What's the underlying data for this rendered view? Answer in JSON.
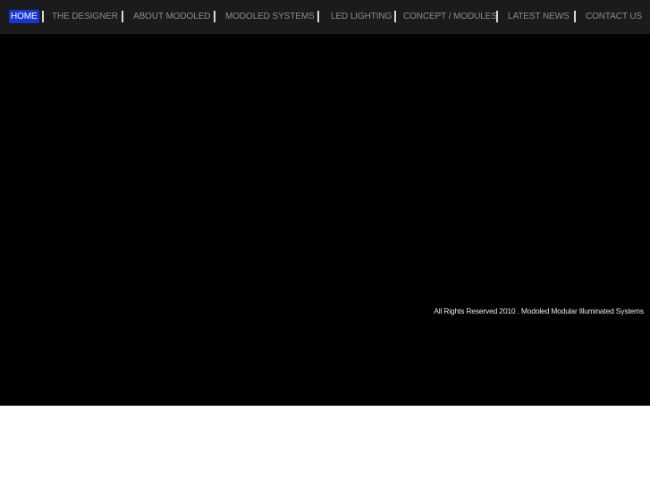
{
  "colors": {
    "nav_background": "#1b1b1b",
    "stage_background": "#000000",
    "page_background": "#ffffff",
    "nav_text": "#8c8c8c",
    "active_highlight": "#1a35d6",
    "separator": "#d9d9d9"
  },
  "nav": {
    "active": "home",
    "items": [
      {
        "id": "home",
        "label": "HOME"
      },
      {
        "id": "designer",
        "label": "THE DESIGNER"
      },
      {
        "id": "about",
        "label": "ABOUT MODOLED"
      },
      {
        "id": "systems",
        "label": "MODOLED SYSTEMS"
      },
      {
        "id": "led",
        "label": "LED LIGHTING"
      },
      {
        "id": "concept",
        "label": "CONCEPT / MODULES"
      },
      {
        "id": "news",
        "label": "LATEST NEWS"
      },
      {
        "id": "contact",
        "label": "CONTACT US"
      }
    ]
  },
  "footer": {
    "credit": "All Rights Reserved 2010 . Modoled Modular Illuminated Systems"
  }
}
